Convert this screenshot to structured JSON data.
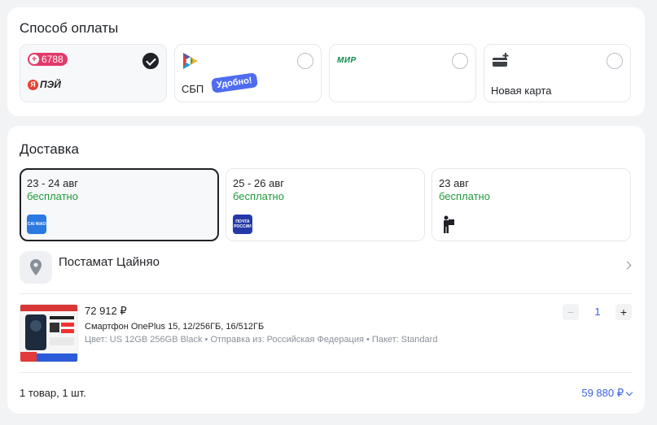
{
  "payment": {
    "title": "Способ оплаты",
    "options": [
      {
        "id": "yandex-pay",
        "badge": "6788",
        "brand": "ПЭЙ",
        "brand_prefix": "Я",
        "selected": true
      },
      {
        "id": "sbp",
        "label": "СБП",
        "sticker": "Удобно!",
        "selected": false
      },
      {
        "id": "mir",
        "logo_text": "МИР",
        "selected": false
      },
      {
        "id": "new-card",
        "label": "Новая карта",
        "selected": false
      }
    ]
  },
  "delivery": {
    "title": "Доставка",
    "options": [
      {
        "date": "23 - 24 авг",
        "price": "бесплатно",
        "carrier_icon": "cainiao-logo",
        "carrier_text": "CAI NIAO",
        "selected": true
      },
      {
        "date": "25 - 26 авг",
        "price": "бесплатно",
        "carrier_icon": "russian-post-logo",
        "carrier_text": "ПОЧТА РОССИИ",
        "selected": false
      },
      {
        "date": "23 авг",
        "price": "бесплатно",
        "carrier_icon": "courier-icon",
        "selected": false
      }
    ],
    "pickup": {
      "label": "Постамат Цайняо",
      "icon": "location-pin-icon"
    }
  },
  "product": {
    "price": "72 912 ₽",
    "name": "Смартфон OnePlus 15, 12/256ГБ, 16/512ГБ",
    "meta": "Цвет: US 12GB 256GB Black • Отправка из: Российская Федерация • Пакет: Standard",
    "quantity": "1",
    "minus_label": "−",
    "plus_label": "+"
  },
  "summary": {
    "count": "1 товар, 1 шт.",
    "total": "59 880 ₽"
  },
  "colors": {
    "accent": "#3b62e0",
    "success": "#1f9a3c",
    "selected_border": "#1f2226"
  }
}
